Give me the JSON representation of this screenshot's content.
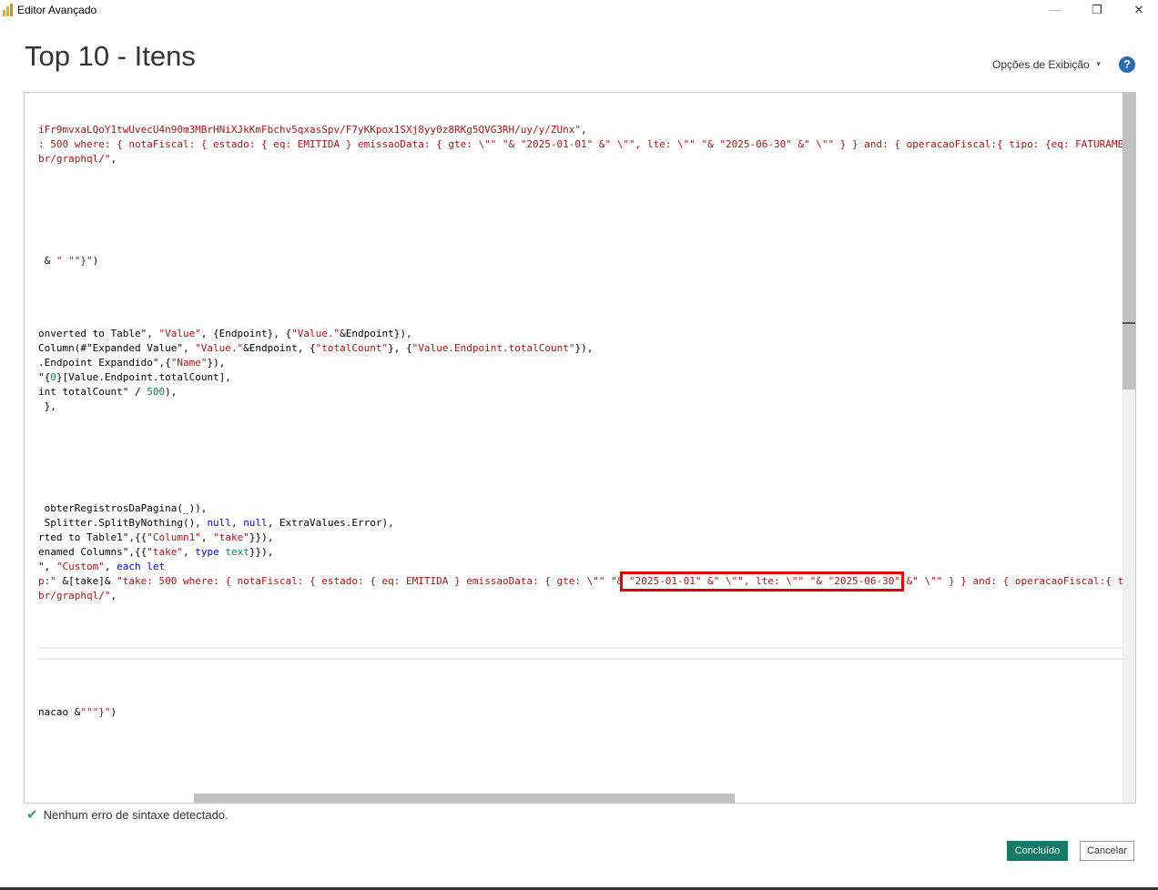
{
  "window": {
    "title": "Editor Avançado",
    "minimize": "—",
    "maximize": "❐",
    "close": "✕"
  },
  "header": {
    "title": "Top 10 - Itens",
    "view_options": "Opções de Exibição",
    "help": "?"
  },
  "code_lines": [
    {
      "row": 0,
      "segs": [
        [
          "s",
          "iFr9mvxaLQoY1twUvecU4n90m3MBrHNiXJkKmFbchv5qxasSpv/F7yKKpox1SXj8yy0z8RKg5QVG3RH/uy/y/ZUnx\""
        ],
        [
          "p",
          ","
        ]
      ]
    },
    {
      "row": 1,
      "segs": [
        [
          "s",
          ": 500 where: { notaFiscal: { estado: { eq: EMITIDA } emissaoData: { gte: \\\"\" \"& \"2025-01-01\" &\" \\\"\", lte: \\\"\" \"& \"2025-06-30\" &\" \\\"\" } } and: { operacaoFiscal:{ tipo: {eq: FATURAMENTO"
        ]
      ]
    },
    {
      "row": 2,
      "segs": [
        [
          "s",
          "br/graphql/\""
        ],
        [
          "p",
          ","
        ]
      ]
    },
    {
      "row": 9,
      "segs": [
        [
          "p",
          " & "
        ],
        [
          "s",
          "\" \"\"}\""
        ],
        [
          "p",
          ")"
        ]
      ]
    },
    {
      "row": 14,
      "segs": [
        [
          "p",
          "onverted to Table\", "
        ],
        [
          "s",
          "\"Value\""
        ],
        [
          "p",
          ", {Endpoint}, {"
        ],
        [
          "s",
          "\"Value.\""
        ],
        [
          "p",
          "&Endpoint}),"
        ]
      ]
    },
    {
      "row": 15,
      "segs": [
        [
          "p",
          "Column(#\"Expanded Value\", "
        ],
        [
          "s",
          "\"Value.\""
        ],
        [
          "p",
          "&Endpoint, {"
        ],
        [
          "s",
          "\"totalCount\""
        ],
        [
          "p",
          "}, {"
        ],
        [
          "s",
          "\"Value.Endpoint.totalCount\""
        ],
        [
          "p",
          "}),"
        ]
      ]
    },
    {
      "row": 16,
      "segs": [
        [
          "p",
          ".Endpoint Expandido\",{"
        ],
        [
          "s",
          "\"Name\""
        ],
        [
          "p",
          "}),"
        ]
      ]
    },
    {
      "row": 17,
      "segs": [
        [
          "p",
          "\"{"
        ],
        [
          "n",
          "0"
        ],
        [
          "p",
          "}[Value.Endpoint.totalCount],"
        ]
      ]
    },
    {
      "row": 18,
      "segs": [
        [
          "p",
          "int totalCount\" / "
        ],
        [
          "n",
          "500"
        ],
        [
          "p",
          "),"
        ]
      ]
    },
    {
      "row": 19,
      "segs": [
        [
          "p",
          " },"
        ]
      ]
    },
    {
      "row": 26,
      "segs": [
        [
          "p",
          " obterRegistrosDaPagina(_)),"
        ]
      ]
    },
    {
      "row": 27,
      "segs": [
        [
          "p",
          " Splitter.SplitByNothing(), "
        ],
        [
          "k",
          "null"
        ],
        [
          "p",
          ", "
        ],
        [
          "k",
          "null"
        ],
        [
          "p",
          ", ExtraValues.Error),"
        ]
      ]
    },
    {
      "row": 28,
      "segs": [
        [
          "p",
          "rted to Table1\",{{"
        ],
        [
          "s",
          "\"Column1\""
        ],
        [
          "p",
          ", "
        ],
        [
          "s",
          "\"take\""
        ],
        [
          "p",
          "}}),"
        ]
      ]
    },
    {
      "row": 29,
      "segs": [
        [
          "p",
          "enamed Columns\",{{"
        ],
        [
          "s",
          "\"take\""
        ],
        [
          "p",
          ", "
        ],
        [
          "k",
          "type"
        ],
        [
          "p",
          " "
        ],
        [
          "n",
          "text"
        ],
        [
          "p",
          "}}),"
        ]
      ]
    },
    {
      "row": 30,
      "segs": [
        [
          "p",
          "\", "
        ],
        [
          "s",
          "\"Custom\""
        ],
        [
          "p",
          ", "
        ],
        [
          "k",
          "each"
        ],
        [
          "p",
          " "
        ],
        [
          "k",
          "let"
        ]
      ]
    },
    {
      "row": 31,
      "segs": [
        [
          "s",
          "p:\" "
        ],
        [
          "p",
          "&[take]& "
        ],
        [
          "s",
          "\"take: 500 where: { notaFiscal: { estado: { eq: EMITIDA } emissaoData: { gte: \\\"\" \"& \"2025-01-01\" &\" \\\"\", lte: \\\"\" \"& \"2025-06-30\" &\" \\\"\" } } and: { operacaoFiscal:{ tipo"
        ]
      ]
    },
    {
      "row": 32,
      "segs": [
        [
          "s",
          "br/graphql/\""
        ],
        [
          "p",
          ","
        ]
      ]
    },
    {
      "row": 40,
      "segs": [
        [
          "p",
          "nacao &"
        ],
        [
          "s",
          "\"\"\"}\""
        ],
        [
          "p",
          ")"
        ]
      ]
    }
  ],
  "status": {
    "icon": "check-icon",
    "text": "Nenhum erro de sintaxe detectado."
  },
  "buttons": {
    "done": "Concluído",
    "cancel": "Cancelar"
  },
  "colors": {
    "primary_button": "#127a66",
    "string": "#a31515",
    "keyword": "#0000ff",
    "number": "#098658",
    "highlight_box": "#e00000"
  }
}
